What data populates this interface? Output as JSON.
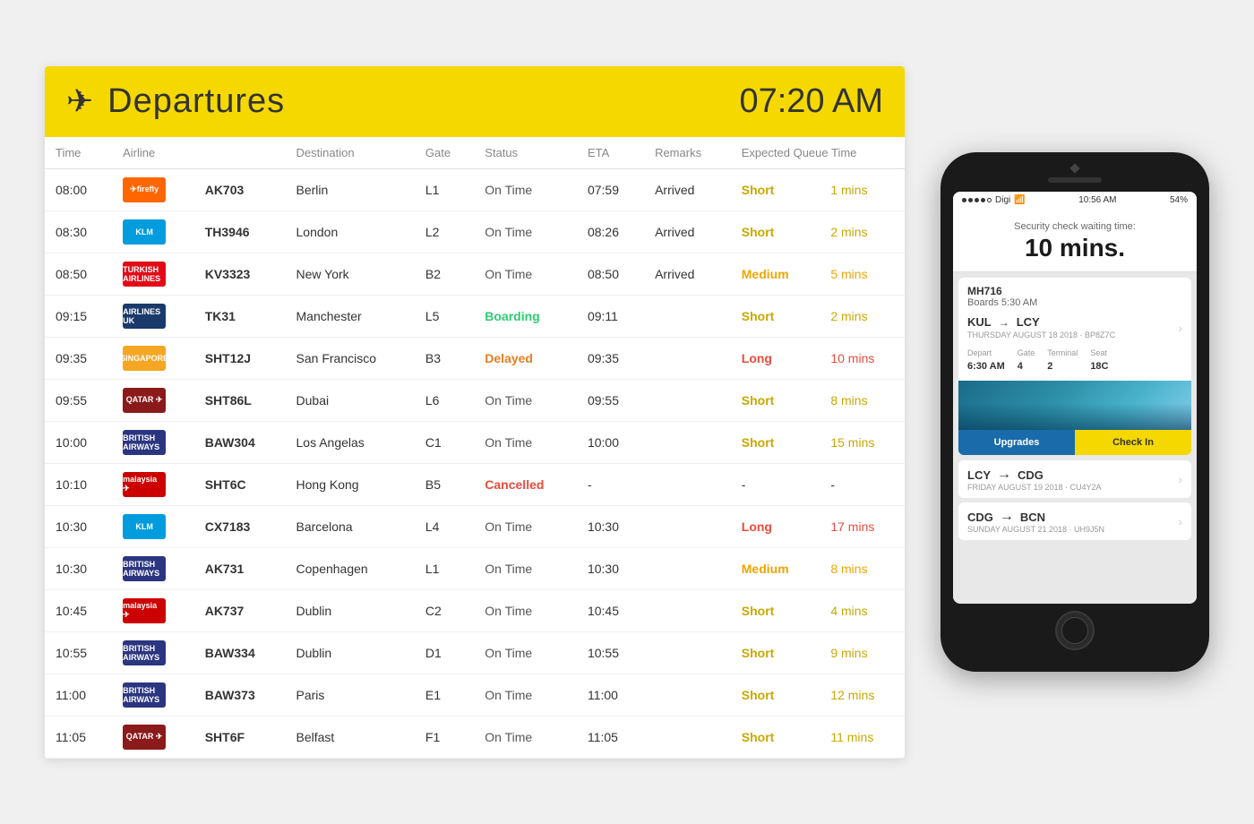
{
  "board": {
    "title": "Departures",
    "time": "07:20 AM",
    "columns": [
      "Time",
      "Airline",
      "",
      "Destination",
      "Gate",
      "Status",
      "ETA",
      "Remarks",
      "Expected Queue Time",
      ""
    ],
    "flights": [
      {
        "time": "08:00",
        "airline_code": "firefly",
        "airline_name": "firefly",
        "flight": "AK703",
        "destination": "Berlin",
        "gate": "L1",
        "status": "On Time",
        "status_class": "status-ontime",
        "eta": "07:59",
        "remarks": "Arrived",
        "queue": "Short",
        "queue_class": "queue-short",
        "mins": "1 mins",
        "mins_class": "queue-mins"
      },
      {
        "time": "08:30",
        "airline_code": "klm",
        "airline_name": "KLM",
        "flight": "TH3946",
        "destination": "London",
        "gate": "L2",
        "status": "On Time",
        "status_class": "status-ontime",
        "eta": "08:26",
        "remarks": "Arrived",
        "queue": "Short",
        "queue_class": "queue-short",
        "mins": "2 mins",
        "mins_class": "queue-mins"
      },
      {
        "time": "08:50",
        "airline_code": "turkish",
        "airline_name": "TURKISH AIRLINES",
        "flight": "KV3323",
        "destination": "New York",
        "gate": "B2",
        "status": "On Time",
        "status_class": "status-ontime",
        "eta": "08:50",
        "remarks": "Arrived",
        "queue": "Medium",
        "queue_class": "queue-medium",
        "mins": "5 mins",
        "mins_class": "queue-mins-medium"
      },
      {
        "time": "09:15",
        "airline_code": "airlines-uk",
        "airline_name": "AIRLINES UK",
        "flight": "TK31",
        "destination": "Manchester",
        "gate": "L5",
        "status": "Boarding",
        "status_class": "status-boarding",
        "eta": "09:11",
        "remarks": "",
        "queue": "Short",
        "queue_class": "queue-short",
        "mins": "2 mins",
        "mins_class": "queue-mins"
      },
      {
        "time": "09:35",
        "airline_code": "singapore",
        "airline_name": "SINGAPORE AIRLINES",
        "flight": "SHT12J",
        "destination": "San Francisco",
        "gate": "B3",
        "status": "Delayed",
        "status_class": "status-delayed",
        "eta": "09:35",
        "remarks": "",
        "queue": "Long",
        "queue_class": "queue-long",
        "mins": "10 mins",
        "mins_class": "queue-mins-long"
      },
      {
        "time": "09:55",
        "airline_code": "qatar",
        "airline_name": "QATAR",
        "flight": "SHT86L",
        "destination": "Dubai",
        "gate": "L6",
        "status": "On Time",
        "status_class": "status-ontime",
        "eta": "09:55",
        "remarks": "",
        "queue": "Short",
        "queue_class": "queue-short",
        "mins": "8 mins",
        "mins_class": "queue-mins"
      },
      {
        "time": "10:00",
        "airline_code": "british",
        "airline_name": "BRITISH AIRWAYS",
        "flight": "BAW304",
        "destination": "Los Angelas",
        "gate": "C1",
        "status": "On Time",
        "status_class": "status-ontime",
        "eta": "10:00",
        "remarks": "",
        "queue": "Short",
        "queue_class": "queue-short",
        "mins": "15 mins",
        "mins_class": "queue-mins"
      },
      {
        "time": "10:10",
        "airline_code": "malaysia",
        "airline_name": "malaysia",
        "flight": "SHT6C",
        "destination": "Hong Kong",
        "gate": "B5",
        "status": "Cancelled",
        "status_class": "status-cancelled",
        "eta": "-",
        "remarks": "",
        "queue": "-",
        "queue_class": "",
        "mins": "-",
        "mins_class": ""
      },
      {
        "time": "10:30",
        "airline_code": "klm",
        "airline_name": "KLM",
        "flight": "CX7183",
        "destination": "Barcelona",
        "gate": "L4",
        "status": "On Time",
        "status_class": "status-ontime",
        "eta": "10:30",
        "remarks": "",
        "queue": "Long",
        "queue_class": "queue-long",
        "mins": "17 mins",
        "mins_class": "queue-mins-long"
      },
      {
        "time": "10:30",
        "airline_code": "british",
        "airline_name": "BRITISH AIRWAYS",
        "flight": "AK731",
        "destination": "Copenhagen",
        "gate": "L1",
        "status": "On Time",
        "status_class": "status-ontime",
        "eta": "10:30",
        "remarks": "",
        "queue": "Medium",
        "queue_class": "queue-medium",
        "mins": "8 mins",
        "mins_class": "queue-mins-medium"
      },
      {
        "time": "10:45",
        "airline_code": "malaysia",
        "airline_name": "malaysia",
        "flight": "AK737",
        "destination": "Dublin",
        "gate": "C2",
        "status": "On Time",
        "status_class": "status-ontime",
        "eta": "10:45",
        "remarks": "",
        "queue": "Short",
        "queue_class": "queue-short",
        "mins": "4 mins",
        "mins_class": "queue-mins"
      },
      {
        "time": "10:55",
        "airline_code": "british",
        "airline_name": "BRITISH AIRWAYS",
        "flight": "BAW334",
        "destination": "Dublin",
        "gate": "D1",
        "status": "On Time",
        "status_class": "status-ontime",
        "eta": "10:55",
        "remarks": "",
        "queue": "Short",
        "queue_class": "queue-short",
        "mins": "9 mins",
        "mins_class": "queue-mins"
      },
      {
        "time": "11:00",
        "airline_code": "british",
        "airline_name": "BRITISH AIRWAYS",
        "flight": "BAW373",
        "destination": "Paris",
        "gate": "E1",
        "status": "On Time",
        "status_class": "status-ontime",
        "eta": "11:00",
        "remarks": "",
        "queue": "Short",
        "queue_class": "queue-short",
        "mins": "12 mins",
        "mins_class": "queue-mins"
      },
      {
        "time": "11:05",
        "airline_code": "qatar",
        "airline_name": "QATAR",
        "flight": "SHT6F",
        "destination": "Belfast",
        "gate": "F1",
        "status": "On Time",
        "status_class": "status-ontime",
        "eta": "11:05",
        "remarks": "",
        "queue": "Short",
        "queue_class": "queue-short",
        "mins": "11 mins",
        "mins_class": "queue-mins"
      }
    ]
  },
  "phone": {
    "carrier": "Digi",
    "time": "10:56 AM",
    "battery": "54%",
    "security_label": "Security check waiting time:",
    "security_time": "10 mins.",
    "flight_number": "MH716",
    "boards_label": "Boards 5:30 AM",
    "route1_from": "KUL",
    "route1_to": "LCY",
    "route1_arrow": "→",
    "route1_date": "THURSDAY AUGUST 18 2018 · BP8Z7C",
    "depart_label": "Depart",
    "depart_value": "6:30 AM",
    "gate_label": "Gate",
    "gate_value": "4",
    "terminal_label": "Terminal",
    "terminal_value": "2",
    "seat_label": "Seat",
    "seat_value": "18C",
    "upgrades_label": "Upgrades",
    "checkin_label": "Check In",
    "route2_from": "LCY",
    "route2_to": "CDG",
    "route2_arrow": "→",
    "route2_date": "FRIDAY AUGUST 19 2018 · CU4Y2A",
    "route3_from": "CDG",
    "route3_to": "BCN",
    "route3_arrow": "→",
    "route3_date": "SUNDAY AUGUST 21 2018 · UH9J5N"
  }
}
